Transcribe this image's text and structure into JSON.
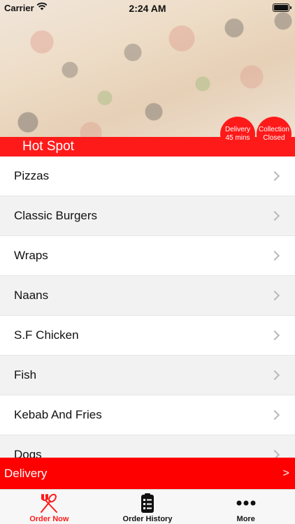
{
  "status_bar": {
    "carrier": "Carrier",
    "time": "2:24 AM"
  },
  "store": {
    "name": "Hot Spot"
  },
  "badges": {
    "delivery": {
      "line1": "Delivery",
      "line2": "45 mins"
    },
    "collection": {
      "line1": "Collection",
      "line2": "Closed"
    }
  },
  "categories": [
    {
      "label": "Pizzas"
    },
    {
      "label": "Classic Burgers"
    },
    {
      "label": "Wraps"
    },
    {
      "label": "Naans"
    },
    {
      "label": "S.F Chicken"
    },
    {
      "label": "Fish"
    },
    {
      "label": "Kebab And Fries"
    },
    {
      "label": "Dogs"
    }
  ],
  "delivery_bar": {
    "label": "Delivery",
    "arrow": ">"
  },
  "tabs": [
    {
      "label": "Order Now",
      "icon": "cutlery-icon"
    },
    {
      "label": "Order History",
      "icon": "clipboard-icon"
    },
    {
      "label": "More",
      "icon": "more-dots-icon"
    }
  ],
  "colors": {
    "accent": "#ff1a1a",
    "tab_inactive": "#111111"
  }
}
